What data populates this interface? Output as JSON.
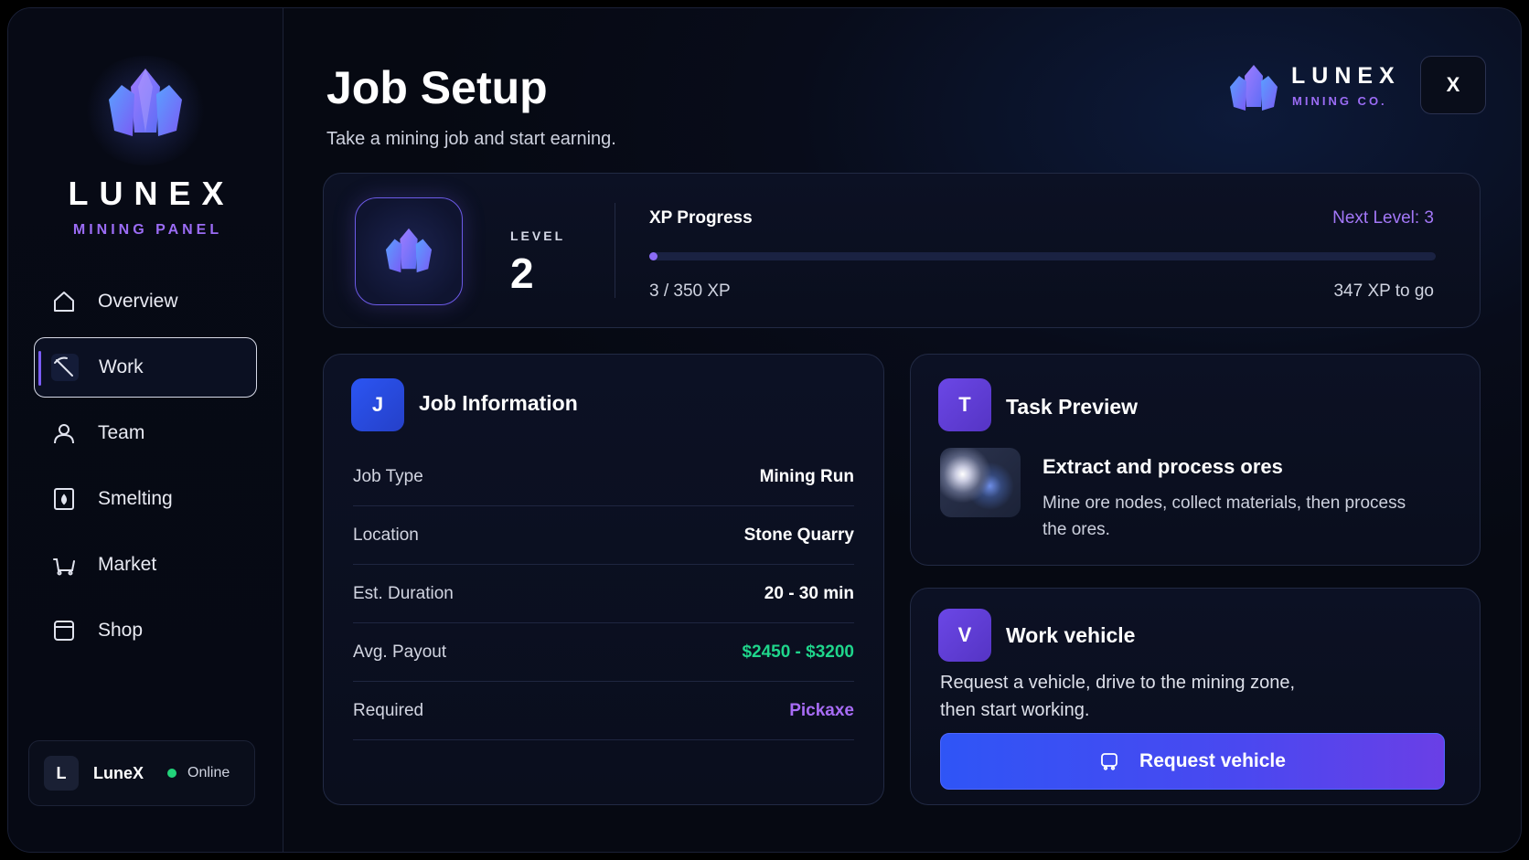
{
  "brand": {
    "title": "LUNEX",
    "subtitle": "MINING PANEL",
    "corner_title": "LUNEX",
    "corner_subtitle": "MINING CO."
  },
  "colors": {
    "accent_purple": "#9b6cf5",
    "accent_blue": "#2f55f6",
    "green": "#1fd58b",
    "online": "#22d37a"
  },
  "sidebar": {
    "items": [
      {
        "label": "Overview",
        "icon": "home-icon",
        "active": false
      },
      {
        "label": "Work",
        "icon": "pickaxe-icon",
        "active": true
      },
      {
        "label": "Team",
        "icon": "user-icon",
        "active": false
      },
      {
        "label": "Smelting",
        "icon": "furnace-icon",
        "active": false
      },
      {
        "label": "Market",
        "icon": "cart-icon",
        "active": false
      },
      {
        "label": "Shop",
        "icon": "store-icon",
        "active": false
      }
    ],
    "user": {
      "initial": "L",
      "name": "LuneX",
      "status": "Online"
    }
  },
  "header": {
    "title": "Job Setup",
    "subtitle": "Take a mining job and start earning.",
    "close_label": "X"
  },
  "level": {
    "label": "LEVEL",
    "value": "2",
    "xp_title": "XP Progress",
    "next_level": "Next Level: 3",
    "xp_count": "3 / 350 XP",
    "xp_remaining": "347 XP to go",
    "progress": 0.0086
  },
  "job": {
    "icon_letter": "J",
    "title": "Job Information",
    "rows": [
      {
        "key": "Job Type",
        "value": "Mining Run"
      },
      {
        "key": "Location",
        "value": "Stone Quarry"
      },
      {
        "key": "Est. Duration",
        "value": "20 - 30 min"
      },
      {
        "key": "Avg. Payout",
        "value": "$2450 - $3200"
      },
      {
        "key": "Required",
        "value": "Pickaxe"
      }
    ]
  },
  "task": {
    "icon_letter": "T",
    "title": "Task Preview",
    "heading": "Extract and process ores",
    "description": "Mine ore nodes, collect materials, then process the ores."
  },
  "vehicle": {
    "icon_letter": "V",
    "title": "Work vehicle",
    "description": "Request a vehicle, drive to the mining zone, then start working.",
    "button_label": "Request vehicle"
  }
}
